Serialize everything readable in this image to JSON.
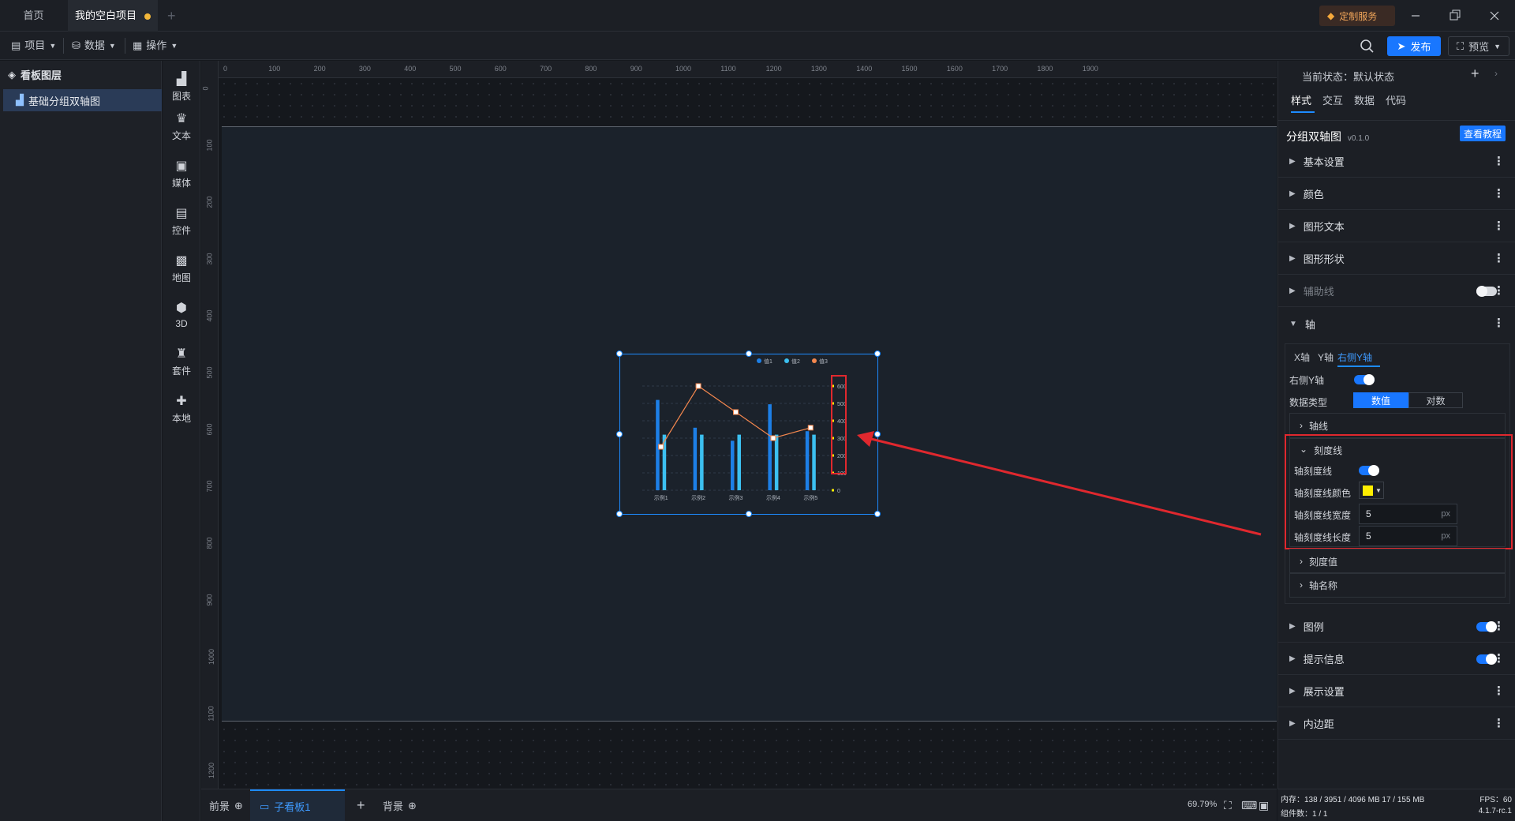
{
  "titlebar": {
    "tabs": [
      {
        "label": "首页"
      },
      {
        "label": "我的空白项目"
      }
    ],
    "custom_service": "定制服务"
  },
  "toolbar": {
    "menus": [
      "项目",
      "数据",
      "操作"
    ],
    "publish_label": "发布",
    "preview_label": "预览"
  },
  "layers": {
    "title": "看板图层",
    "items": [
      "基础分组双轴图"
    ]
  },
  "palette": {
    "items": [
      "图表",
      "文本",
      "媒体",
      "控件",
      "地图",
      "3D",
      "套件",
      "本地"
    ]
  },
  "ruler": {
    "top": [
      "0",
      "100",
      "200",
      "300",
      "400",
      "500",
      "600",
      "700",
      "800",
      "900",
      "1000",
      "1100",
      "1200",
      "1300",
      "1400",
      "1500",
      "1600",
      "1700",
      "1800",
      "1900"
    ],
    "left": [
      "0",
      "100",
      "200",
      "300",
      "400",
      "500",
      "600",
      "700",
      "800",
      "900",
      "1000",
      "1100",
      "1200"
    ]
  },
  "chart_data": {
    "type": "bar",
    "categories": [
      "示例1",
      "示例2",
      "示例3",
      "示例4",
      "示例5"
    ],
    "series": [
      {
        "name": "值1",
        "type": "bar",
        "values": [
          520,
          360,
          285,
          495,
          340
        ],
        "color": "#1d7fe6"
      },
      {
        "name": "值2",
        "type": "bar",
        "values": [
          320,
          320,
          320,
          320,
          320
        ],
        "color": "#3cc0f0"
      },
      {
        "name": "值3",
        "type": "line",
        "axis": "right",
        "values": [
          250,
          600,
          450,
          300,
          360
        ],
        "color": "#f4874e"
      }
    ],
    "right_axis_ticks": [
      "0",
      "100",
      "200",
      "300",
      "400",
      "500",
      "600"
    ],
    "ylim": [
      0,
      600
    ],
    "legend": "top-right"
  },
  "bottombar": {
    "foreground": "前景",
    "board_tab": "子看板1",
    "background": "背景",
    "zoom": "69.79%"
  },
  "rpanel": {
    "state_label": "当前状态：默认状态",
    "tabs": [
      "样式",
      "交互",
      "数据",
      "代码"
    ],
    "component_name": "分组双轴图",
    "version": "v0.1.0",
    "tutorial_btn": "查看教程",
    "sections_top": [
      "基本设置",
      "颜色",
      "图形文本",
      "图形形状",
      "辅助线",
      "轴"
    ],
    "axis_tabs": [
      "X轴",
      "Y轴",
      "右侧Y轴"
    ],
    "right_y_label": "右侧Y轴",
    "data_type_label": "数据类型",
    "data_type_options": [
      "数值",
      "对数"
    ],
    "axis_line": "轴线",
    "tick_line": "刻度线",
    "tick_show_label": "轴刻度线",
    "tick_color_label": "轴刻度线颜色",
    "tick_color": "#ffee00",
    "tick_width_label": "轴刻度线宽度",
    "tick_width": "5",
    "tick_length_label": "轴刻度线长度",
    "tick_length": "5",
    "unit": "px",
    "tick_value": "刻度值",
    "axis_name": "轴名称",
    "sections_bottom": [
      "图例",
      "提示信息",
      "展示设置",
      "内边距"
    ]
  },
  "status": {
    "memory": "内存：138 / 3951 / 4096 MB  17 / 155 MB",
    "fps": "FPS：60",
    "components": "组件数：1 / 1",
    "version": "4.1.7-rc.1"
  }
}
